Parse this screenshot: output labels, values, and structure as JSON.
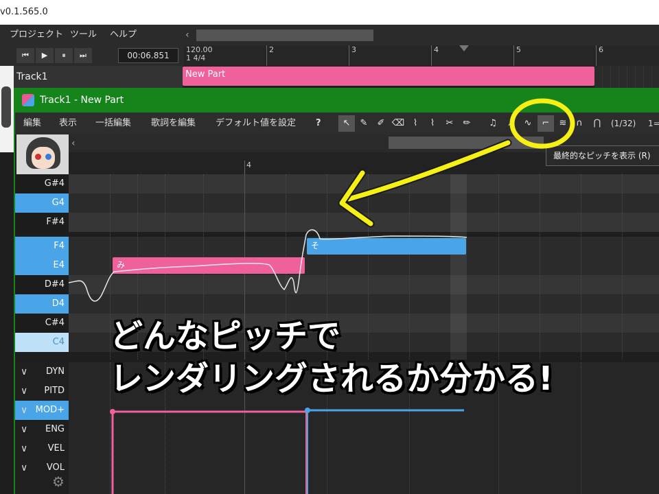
{
  "window": {
    "title": "v0.1.565.0"
  },
  "main_menu": [
    "プロジェクト",
    "ツール",
    "ヘルプ"
  ],
  "transport": {
    "buttons": [
      "first-icon",
      "play-icon",
      "pause-icon",
      "last-icon"
    ],
    "time": "00:06.851"
  },
  "ruler": {
    "tempo": "120.00",
    "signature": "1 4/4",
    "bars": [
      "2",
      "3",
      "4",
      "5",
      "6"
    ]
  },
  "track": {
    "name": "Track1",
    "part_name": "New Part"
  },
  "piano_roll": {
    "title": "Track1 - New Part",
    "menu": [
      "編集",
      "表示",
      "一括編集",
      "歌詞を編集",
      "デフォルト値を設定"
    ],
    "help_glyph": "?",
    "snap": "(1/32)",
    "snap2": "1=",
    "tooltip": "最終的なピッチを表示 (R)",
    "bar_label": "4",
    "keys": [
      {
        "name": "G#4",
        "kind": "black"
      },
      {
        "name": "G4",
        "kind": "white"
      },
      {
        "name": "F#4",
        "kind": "black"
      },
      {
        "name": "F4",
        "kind": "white"
      },
      {
        "name": "E4",
        "kind": "white"
      },
      {
        "name": "D#4",
        "kind": "black"
      },
      {
        "name": "D4",
        "kind": "white"
      },
      {
        "name": "C#4",
        "kind": "black"
      },
      {
        "name": "C4",
        "kind": "c"
      }
    ],
    "notes": [
      {
        "lyric": "み",
        "pitch": "E4",
        "color": "#f0609a"
      },
      {
        "lyric": "そ",
        "pitch": "F4",
        "color": "#4aa5e8"
      }
    ],
    "expressions": [
      {
        "name": "DYN",
        "selected": false
      },
      {
        "name": "PITD",
        "selected": false
      },
      {
        "name": "MOD+",
        "selected": true
      },
      {
        "name": "ENG",
        "selected": false
      },
      {
        "name": "VEL",
        "selected": false
      },
      {
        "name": "VOL",
        "selected": false
      }
    ]
  },
  "caption": {
    "line1": "どんなピッチで",
    "line2": "レンダリングされるか分かる!"
  },
  "colors": {
    "accent_green": "#15851b",
    "note_pink": "#f0609a",
    "note_blue": "#4aa5e8",
    "highlight_yellow": "#f7f014"
  }
}
